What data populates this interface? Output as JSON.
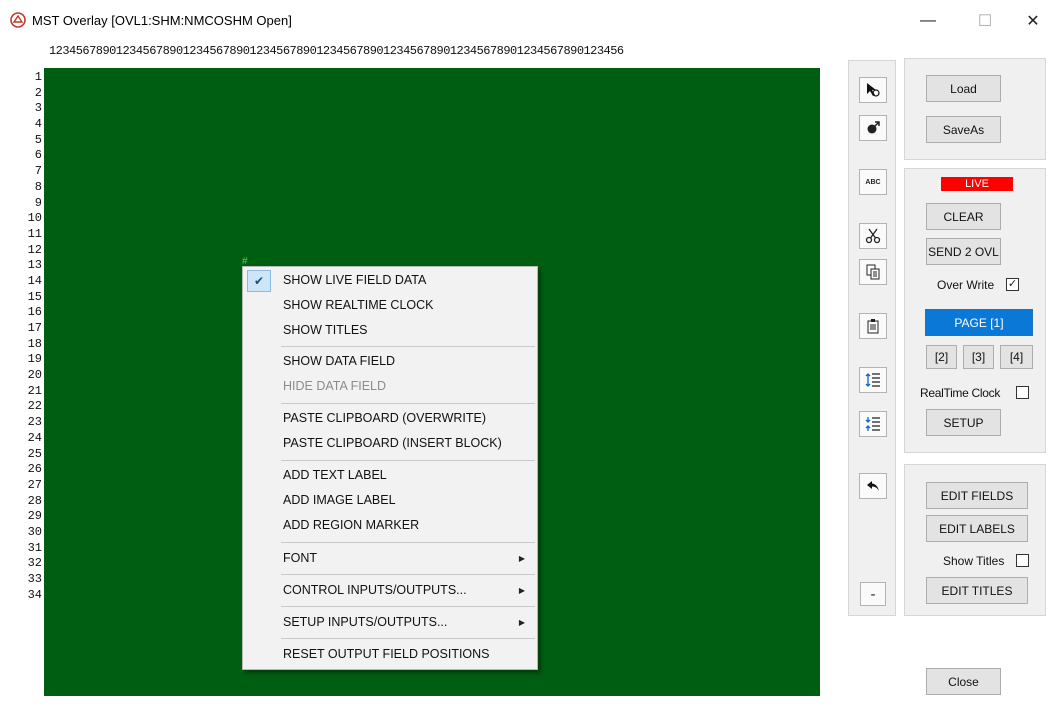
{
  "window": {
    "title": "MST Overlay  [OVL1:SHM:NMCOSHM Open]",
    "minimize": "—",
    "maximize": "☐",
    "close": "✕"
  },
  "ruler": "12345678901234567890123456789012345678901234567890123456789012345678901234567890123456",
  "rows": [
    "1",
    "2",
    "3",
    "4",
    "5",
    "6",
    "7",
    "8",
    "9",
    "10",
    "11",
    "12",
    "13",
    "14",
    "15",
    "16",
    "17",
    "18",
    "19",
    "20",
    "21",
    "22",
    "23",
    "24",
    "25",
    "26",
    "27",
    "28",
    "29",
    "30",
    "31",
    "32",
    "33",
    "34"
  ],
  "canvas": {
    "background": "#005e12",
    "cursor_mark": "#"
  },
  "context_menu": {
    "items": [
      {
        "label": "SHOW LIVE FIELD DATA",
        "checked": true
      },
      {
        "label": "SHOW REALTIME CLOCK"
      },
      {
        "label": "SHOW TITLES"
      },
      {
        "label": "SHOW DATA FIELD"
      },
      {
        "label": "HIDE DATA FIELD",
        "disabled": true
      },
      {
        "label": "PASTE CLIPBOARD (OVERWRITE)"
      },
      {
        "label": "PASTE CLIPBOARD (INSERT BLOCK)"
      },
      {
        "label": "ADD TEXT LABEL"
      },
      {
        "label": "ADD IMAGE LABEL"
      },
      {
        "label": "ADD REGION MARKER"
      },
      {
        "label": "FONT",
        "submenu": true
      },
      {
        "label": "CONTROL INPUTS/OUTPUTS...",
        "submenu": true
      },
      {
        "label": "SETUP INPUTS/OUTPUTS...",
        "submenu": true
      },
      {
        "label": "RESET OUTPUT FIELD POSITIONS"
      }
    ],
    "check_glyph": "✔",
    "arrow_glyph": "▶"
  },
  "toolstrip": {
    "icons": [
      "pointer-select-icon",
      "move-icon",
      "text-label-icon",
      "cut-icon",
      "copy-icon",
      "paste-icon",
      "insert-lines-icon",
      "delete-lines-icon",
      "undo-icon"
    ],
    "abc": "ABC",
    "minus": "-"
  },
  "right_panel": {
    "load": "Load",
    "save_as": "SaveAs",
    "live": "LIVE",
    "clear": "CLEAR",
    "send_ovl": "SEND 2 OVL",
    "over_write": "Over Write",
    "over_write_checked": true,
    "page": "PAGE [1]",
    "page_2": "[2]",
    "page_3": "[3]",
    "page_4": "[4]",
    "realtime_clock": "RealTime Clock",
    "realtime_clock_checked": false,
    "setup": "SETUP",
    "edit_fields": "EDIT FIELDS",
    "edit_labels": "EDIT LABELS",
    "show_titles": "Show Titles",
    "show_titles_checked": false,
    "edit_titles": "EDIT TITLES",
    "close": "Close"
  },
  "colors": {
    "live_red": "#ff0000",
    "page_blue": "#0a78d7",
    "canvas_green": "#005e12"
  }
}
